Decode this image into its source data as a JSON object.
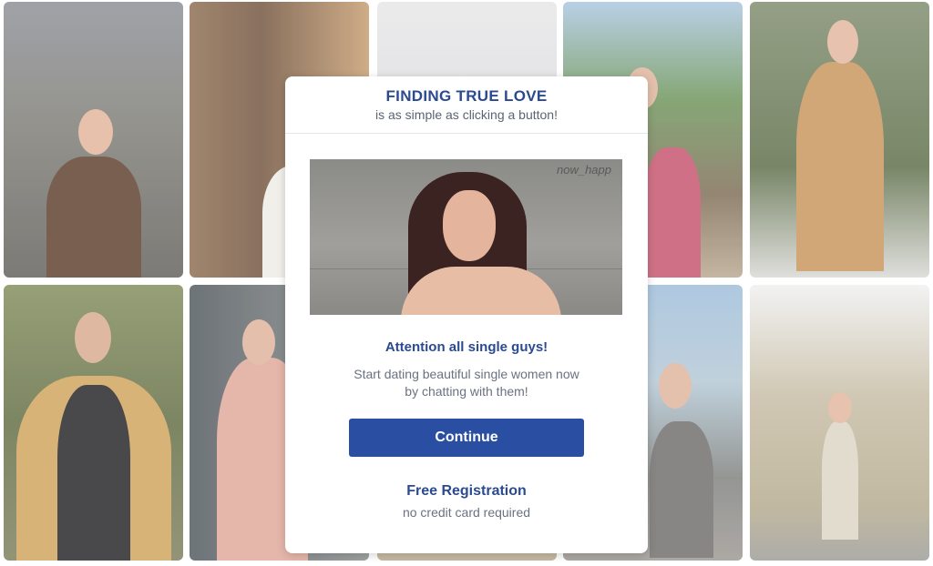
{
  "modal": {
    "title": "FINDING TRUE LOVE",
    "subtitle": "is as simple as clicking a button!",
    "photo_wall_text": "now_happ",
    "attention": "Attention all single guys!",
    "description_line1": "Start dating beautiful single women now",
    "description_line2": "by chatting with them!",
    "continue_label": "Continue",
    "free_registration": "Free Registration",
    "no_credit_card": "no credit card required"
  },
  "colors": {
    "accent_text": "#2b4a8f",
    "button_bg": "#2a4ea2",
    "muted_text": "#6a7280"
  },
  "tiles": [
    {
      "name": "photo-tile-1",
      "bg": "#7d7a72",
      "person": "#2d2622",
      "skin": "#e2b49a"
    },
    {
      "name": "photo-tile-2",
      "bg": "#7b5a3f",
      "person": "#e9e6e2",
      "skin": "#e0b59c"
    },
    {
      "name": "photo-tile-3",
      "bg": "#d8d8da",
      "person": "#cfcfd1",
      "skin": "#d8b39c"
    },
    {
      "name": "photo-tile-4",
      "bg": "#6f8f58",
      "person": "#c9506e",
      "skin": "#dfb39a"
    },
    {
      "name": "photo-tile-5",
      "bg": "#5f6d4c",
      "person": "#c8935a",
      "skin": "#e2b59c"
    },
    {
      "name": "photo-tile-6",
      "bg": "#6c6f45",
      "person": "#d4a45a",
      "skin": "#d8a98e"
    },
    {
      "name": "photo-tile-7",
      "bg": "#5a5e64",
      "person": "#e2a99a",
      "skin": "#dfb19a"
    },
    {
      "name": "photo-tile-8",
      "bg": "#c9b99c",
      "person": "#d9d0c4",
      "skin": "#d8b39c"
    },
    {
      "name": "photo-tile-9",
      "bg": "#8fb0c9",
      "person": "#6f6d6a",
      "skin": "#dfb39a"
    },
    {
      "name": "photo-tile-10",
      "bg": "#b9ad92",
      "person": "#dcd5c5",
      "skin": "#e2b59c"
    }
  ]
}
